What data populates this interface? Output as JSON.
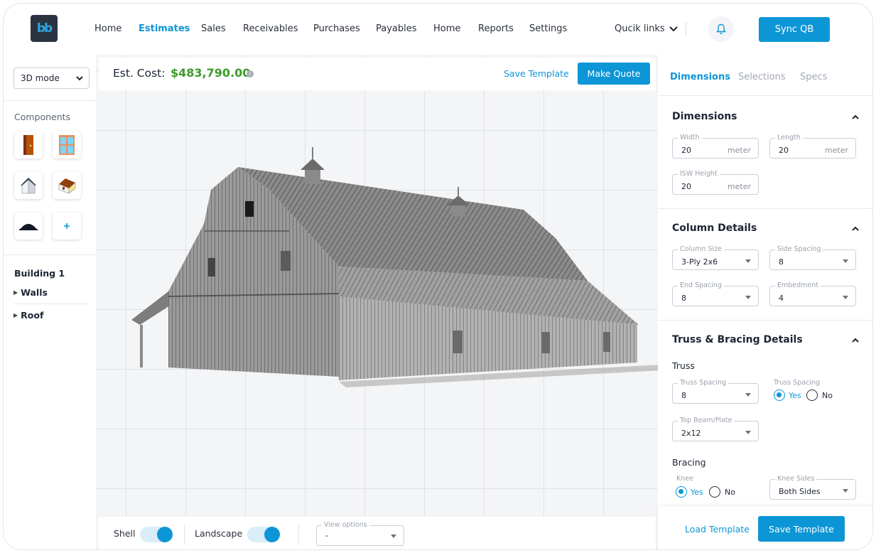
{
  "nav": {
    "logo_text": "bb",
    "items": [
      {
        "label": "Home",
        "active": false
      },
      {
        "label": "Estimates",
        "active": true
      },
      {
        "label": "Sales",
        "active": false
      },
      {
        "label": "Receivables",
        "active": false
      },
      {
        "label": "Purchases",
        "active": false
      },
      {
        "label": "Payables",
        "active": false
      },
      {
        "label": "Home",
        "active": false
      },
      {
        "label": "Reports",
        "active": false
      },
      {
        "label": "Settings",
        "active": false
      }
    ],
    "quick_links": "Qucik links",
    "sync_label": "Sync QB"
  },
  "left": {
    "mode_value": "3D mode",
    "components_title": "Components",
    "components": [
      "door-icon",
      "window-icon",
      "gable-house-icon",
      "lean-to-house-icon",
      "dome-roof-icon",
      "plus-icon"
    ],
    "building_title": "Building 1",
    "tree": [
      "Walls",
      "Roof"
    ]
  },
  "toolbar": {
    "cost_label": "Est. Cost:",
    "cost_value": "$483,790.00",
    "save_template": "Save Template",
    "make_quote": "Make Quote"
  },
  "bottom": {
    "shell_label": "Shell",
    "shell_on": true,
    "landscape_label": "Landscape",
    "landscape_on": true,
    "view_options_legend": "View options",
    "view_options_value": "-"
  },
  "right": {
    "tabs": [
      {
        "label": "Dimensions",
        "active": true
      },
      {
        "label": "Selections",
        "active": false
      },
      {
        "label": "Specs",
        "active": false
      }
    ],
    "dimensions": {
      "title": "Dimensions",
      "width": {
        "legend": "Width",
        "value": "20",
        "unit": "meter"
      },
      "length": {
        "legend": "Length",
        "value": "20",
        "unit": "meter"
      },
      "isw_height": {
        "legend": "ISW Height",
        "value": "20",
        "unit": "meter"
      }
    },
    "columns": {
      "title": "Column Details",
      "column_size": {
        "legend": "Column Size",
        "value": "3-Ply 2x6"
      },
      "side_spacing": {
        "legend": "Side Spacing",
        "value": "8"
      },
      "end_spacing": {
        "legend": "End Spacing",
        "value": "8"
      },
      "embedment": {
        "legend": "Embedment",
        "value": "4"
      }
    },
    "truss": {
      "title": "Truss & Bracing Details",
      "truss_label": "Truss",
      "truss_spacing": {
        "legend": "Truss Spacing",
        "value": "8"
      },
      "truss_spacing_radio": {
        "legend": "Truss Spacing",
        "yes": "Yes",
        "no": "No",
        "selected": "Yes"
      },
      "top_beam": {
        "legend": "Top Beam/Plate",
        "value": "2x12"
      },
      "bracing_label": "Bracing",
      "knee": {
        "legend": "Knee",
        "yes": "Yes",
        "no": "No",
        "selected": "Yes"
      },
      "knee_sides": {
        "legend": "Knee Sides",
        "value": "Both Sides"
      }
    },
    "footer": {
      "load_template": "Load Template",
      "save_template": "Save Template"
    }
  },
  "colors": {
    "accent": "#0d96d6",
    "cost_green": "#3d9b2a",
    "barn_gray": "#8a8a8a"
  }
}
